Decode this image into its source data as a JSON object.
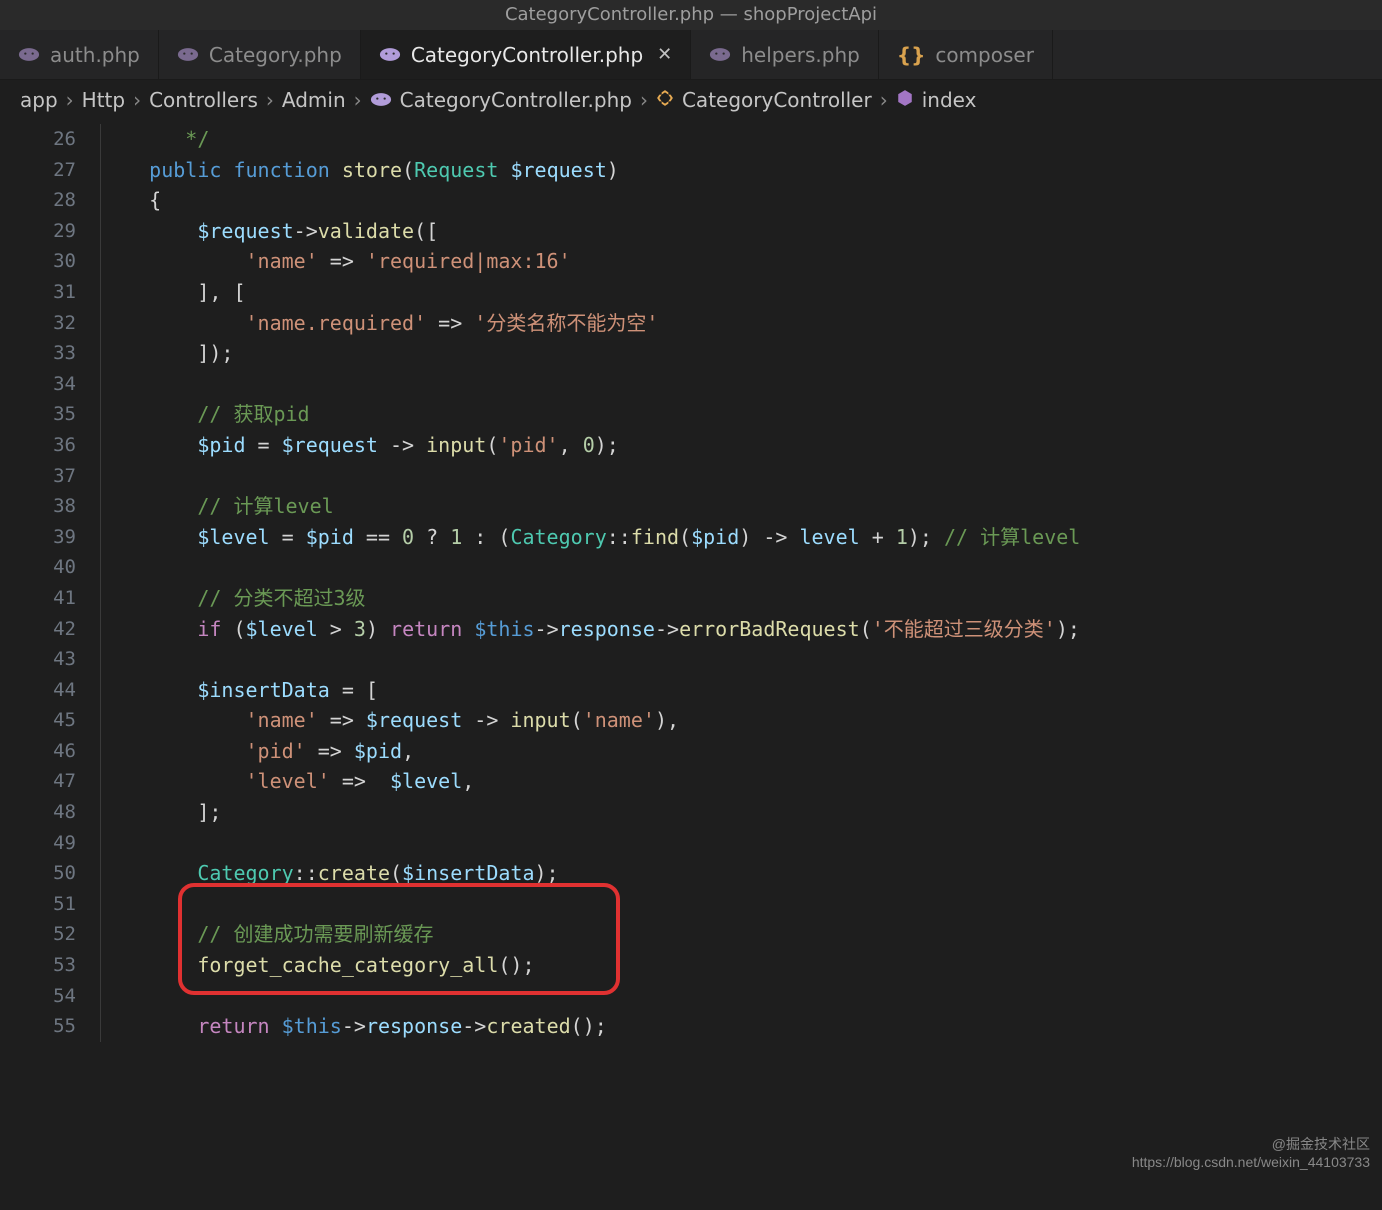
{
  "window": {
    "title": "CategoryController.php — shopProjectApi"
  },
  "tabs": [
    {
      "label": "auth.php",
      "icon": "php",
      "active": false
    },
    {
      "label": "Category.php",
      "icon": "php",
      "active": false
    },
    {
      "label": "CategoryController.php",
      "icon": "php",
      "active": true
    },
    {
      "label": "helpers.php",
      "icon": "php",
      "active": false
    },
    {
      "label": "composer",
      "icon": "braces",
      "active": false
    }
  ],
  "breadcrumbs": {
    "segments": [
      "app",
      "Http",
      "Controllers",
      "Admin",
      "CategoryController.php",
      "CategoryController",
      "index"
    ]
  },
  "code": {
    "first_line": 26,
    "lines": [
      {
        "n": 26,
        "tokens": [
          {
            "t": "       ",
            "c": ""
          },
          {
            "t": "*/",
            "c": "k-comment"
          }
        ]
      },
      {
        "n": 27,
        "tokens": [
          {
            "t": "    ",
            "c": ""
          },
          {
            "t": "public",
            "c": "k-blue"
          },
          {
            "t": " ",
            "c": ""
          },
          {
            "t": "function",
            "c": "k-blue"
          },
          {
            "t": " ",
            "c": ""
          },
          {
            "t": "store",
            "c": "k-func"
          },
          {
            "t": "(",
            "c": "k-white"
          },
          {
            "t": "Request",
            "c": "k-teal"
          },
          {
            "t": " ",
            "c": ""
          },
          {
            "t": "$request",
            "c": "k-var"
          },
          {
            "t": ")",
            "c": "k-white"
          }
        ]
      },
      {
        "n": 28,
        "tokens": [
          {
            "t": "    ",
            "c": ""
          },
          {
            "t": "{",
            "c": "k-white"
          }
        ]
      },
      {
        "n": 29,
        "tokens": [
          {
            "t": "        ",
            "c": ""
          },
          {
            "t": "$request",
            "c": "k-var"
          },
          {
            "t": "->",
            "c": "k-white"
          },
          {
            "t": "validate",
            "c": "k-func"
          },
          {
            "t": "([",
            "c": "k-white"
          }
        ]
      },
      {
        "n": 30,
        "tokens": [
          {
            "t": "            ",
            "c": ""
          },
          {
            "t": "'name'",
            "c": "k-str"
          },
          {
            "t": " => ",
            "c": "k-white"
          },
          {
            "t": "'required|max:16'",
            "c": "k-str"
          }
        ]
      },
      {
        "n": 31,
        "tokens": [
          {
            "t": "        ",
            "c": ""
          },
          {
            "t": "], [",
            "c": "k-white"
          }
        ]
      },
      {
        "n": 32,
        "tokens": [
          {
            "t": "            ",
            "c": ""
          },
          {
            "t": "'name.required'",
            "c": "k-str"
          },
          {
            "t": " => ",
            "c": "k-white"
          },
          {
            "t": "'分类名称不能为空'",
            "c": "k-str"
          }
        ]
      },
      {
        "n": 33,
        "tokens": [
          {
            "t": "        ",
            "c": ""
          },
          {
            "t": "]);",
            "c": "k-white"
          }
        ]
      },
      {
        "n": 34,
        "tokens": []
      },
      {
        "n": 35,
        "tokens": [
          {
            "t": "        ",
            "c": ""
          },
          {
            "t": "// 获取pid",
            "c": "k-comment"
          }
        ]
      },
      {
        "n": 36,
        "tokens": [
          {
            "t": "        ",
            "c": ""
          },
          {
            "t": "$pid",
            "c": "k-var"
          },
          {
            "t": " = ",
            "c": "k-white"
          },
          {
            "t": "$request",
            "c": "k-var"
          },
          {
            "t": " -> ",
            "c": "k-white"
          },
          {
            "t": "input",
            "c": "k-func"
          },
          {
            "t": "(",
            "c": "k-white"
          },
          {
            "t": "'pid'",
            "c": "k-str"
          },
          {
            "t": ", ",
            "c": "k-white"
          },
          {
            "t": "0",
            "c": "k-num"
          },
          {
            "t": ");",
            "c": "k-white"
          }
        ]
      },
      {
        "n": 37,
        "tokens": []
      },
      {
        "n": 38,
        "tokens": [
          {
            "t": "        ",
            "c": ""
          },
          {
            "t": "// 计算level",
            "c": "k-comment"
          }
        ]
      },
      {
        "n": 39,
        "tokens": [
          {
            "t": "        ",
            "c": ""
          },
          {
            "t": "$level",
            "c": "k-var"
          },
          {
            "t": " = ",
            "c": "k-white"
          },
          {
            "t": "$pid",
            "c": "k-var"
          },
          {
            "t": " == ",
            "c": "k-white"
          },
          {
            "t": "0",
            "c": "k-num"
          },
          {
            "t": " ? ",
            "c": "k-white"
          },
          {
            "t": "1",
            "c": "k-num"
          },
          {
            "t": " : (",
            "c": "k-white"
          },
          {
            "t": "Category",
            "c": "k-teal"
          },
          {
            "t": "::",
            "c": "k-white"
          },
          {
            "t": "find",
            "c": "k-func"
          },
          {
            "t": "(",
            "c": "k-white"
          },
          {
            "t": "$pid",
            "c": "k-var"
          },
          {
            "t": ") -> ",
            "c": "k-white"
          },
          {
            "t": "level",
            "c": "k-var"
          },
          {
            "t": " + ",
            "c": "k-white"
          },
          {
            "t": "1",
            "c": "k-num"
          },
          {
            "t": "); ",
            "c": "k-white"
          },
          {
            "t": "// 计算level",
            "c": "k-comment"
          }
        ]
      },
      {
        "n": 40,
        "tokens": []
      },
      {
        "n": 41,
        "tokens": [
          {
            "t": "        ",
            "c": ""
          },
          {
            "t": "// 分类不超过3级",
            "c": "k-comment"
          }
        ]
      },
      {
        "n": 42,
        "tokens": [
          {
            "t": "        ",
            "c": ""
          },
          {
            "t": "if",
            "c": "k-pink"
          },
          {
            "t": " (",
            "c": "k-white"
          },
          {
            "t": "$level",
            "c": "k-var"
          },
          {
            "t": " > ",
            "c": "k-white"
          },
          {
            "t": "3",
            "c": "k-num"
          },
          {
            "t": ") ",
            "c": "k-white"
          },
          {
            "t": "return",
            "c": "k-pink"
          },
          {
            "t": " ",
            "c": ""
          },
          {
            "t": "$this",
            "c": "k-blue"
          },
          {
            "t": "->",
            "c": "k-white"
          },
          {
            "t": "response",
            "c": "k-var"
          },
          {
            "t": "->",
            "c": "k-white"
          },
          {
            "t": "errorBadRequest",
            "c": "k-func"
          },
          {
            "t": "(",
            "c": "k-white"
          },
          {
            "t": "'不能超过三级分类'",
            "c": "k-str"
          },
          {
            "t": ");",
            "c": "k-white"
          }
        ]
      },
      {
        "n": 43,
        "tokens": []
      },
      {
        "n": 44,
        "tokens": [
          {
            "t": "        ",
            "c": ""
          },
          {
            "t": "$insertData",
            "c": "k-var"
          },
          {
            "t": " = [",
            "c": "k-white"
          }
        ]
      },
      {
        "n": 45,
        "tokens": [
          {
            "t": "            ",
            "c": ""
          },
          {
            "t": "'name'",
            "c": "k-str"
          },
          {
            "t": " => ",
            "c": "k-white"
          },
          {
            "t": "$request",
            "c": "k-var"
          },
          {
            "t": " -> ",
            "c": "k-white"
          },
          {
            "t": "input",
            "c": "k-func"
          },
          {
            "t": "(",
            "c": "k-white"
          },
          {
            "t": "'name'",
            "c": "k-str"
          },
          {
            "t": "),",
            "c": "k-white"
          }
        ]
      },
      {
        "n": 46,
        "tokens": [
          {
            "t": "            ",
            "c": ""
          },
          {
            "t": "'pid'",
            "c": "k-str"
          },
          {
            "t": " => ",
            "c": "k-white"
          },
          {
            "t": "$pid",
            "c": "k-var"
          },
          {
            "t": ",",
            "c": "k-white"
          }
        ]
      },
      {
        "n": 47,
        "tokens": [
          {
            "t": "            ",
            "c": ""
          },
          {
            "t": "'level'",
            "c": "k-str"
          },
          {
            "t": " =>  ",
            "c": "k-white"
          },
          {
            "t": "$level",
            "c": "k-var"
          },
          {
            "t": ",",
            "c": "k-white"
          }
        ]
      },
      {
        "n": 48,
        "tokens": [
          {
            "t": "        ",
            "c": ""
          },
          {
            "t": "];",
            "c": "k-white"
          }
        ]
      },
      {
        "n": 49,
        "tokens": []
      },
      {
        "n": 50,
        "tokens": [
          {
            "t": "        ",
            "c": ""
          },
          {
            "t": "Category",
            "c": "k-teal"
          },
          {
            "t": "::",
            "c": "k-white"
          },
          {
            "t": "create",
            "c": "k-func"
          },
          {
            "t": "(",
            "c": "k-white"
          },
          {
            "t": "$insertData",
            "c": "k-var"
          },
          {
            "t": ");",
            "c": "k-white"
          }
        ]
      },
      {
        "n": 51,
        "tokens": []
      },
      {
        "n": 52,
        "tokens": [
          {
            "t": "        ",
            "c": ""
          },
          {
            "t": "// 创建成功需要刷新缓存",
            "c": "k-comment"
          }
        ]
      },
      {
        "n": 53,
        "tokens": [
          {
            "t": "        ",
            "c": ""
          },
          {
            "t": "forget_cache_category_all",
            "c": "k-func"
          },
          {
            "t": "();",
            "c": "k-white"
          }
        ]
      },
      {
        "n": 54,
        "tokens": []
      },
      {
        "n": 55,
        "tokens": [
          {
            "t": "        ",
            "c": ""
          },
          {
            "t": "return",
            "c": "k-pink"
          },
          {
            "t": " ",
            "c": ""
          },
          {
            "t": "$this",
            "c": "k-blue"
          },
          {
            "t": "->",
            "c": "k-white"
          },
          {
            "t": "response",
            "c": "k-var"
          },
          {
            "t": "->",
            "c": "k-white"
          },
          {
            "t": "created",
            "c": "k-func"
          },
          {
            "t": "();",
            "c": "k-white"
          }
        ]
      }
    ]
  },
  "highlight": {
    "line_start": 51,
    "line_end": 54
  },
  "watermark": {
    "line1": "@掘金技术社区",
    "line2": "https://blog.csdn.net/weixin_44103733"
  }
}
